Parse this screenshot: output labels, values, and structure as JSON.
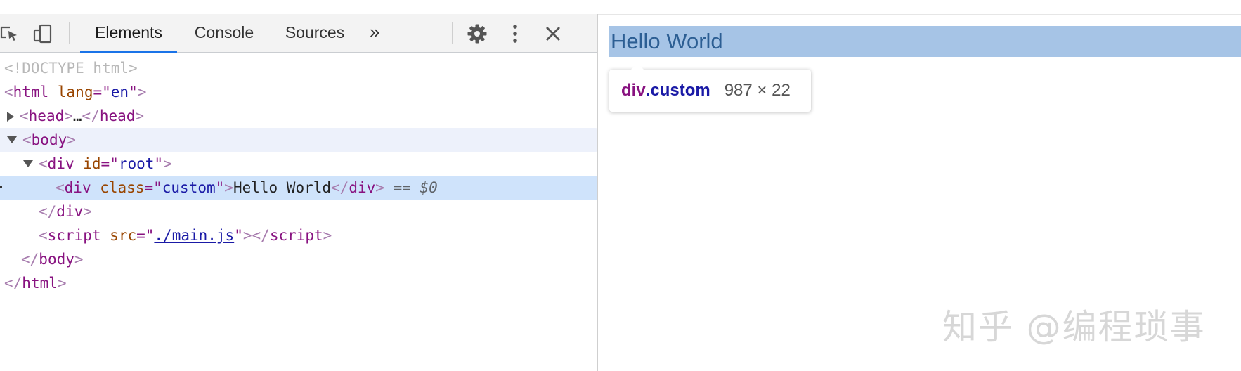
{
  "devtools": {
    "tabs": [
      {
        "label": "Elements",
        "active": true
      },
      {
        "label": "Console",
        "active": false
      },
      {
        "label": "Sources",
        "active": false
      }
    ],
    "more_tabs": "»",
    "icons": [
      "inspect-element-icon",
      "device-toggle-icon",
      "settings-gear-icon",
      "kebab-menu-icon",
      "close-icon"
    ]
  },
  "tree": {
    "doctype": "<!DOCTYPE html>",
    "html_tag": "html",
    "lang_attr": "lang",
    "lang_value": "en",
    "head_tag": "head",
    "head_ellipsis": "…",
    "body_tag": "body",
    "div_tag": "div",
    "id_attr": "id",
    "id_value": "root",
    "class_attr": "class",
    "class_value": "custom",
    "selected_text": "Hello World",
    "selected_marker_eq": "==",
    "selected_marker_var": "$0",
    "script_tag": "script",
    "src_attr": "src",
    "src_value": "./main.js"
  },
  "page": {
    "hello_text": "Hello World",
    "tooltip": {
      "tag": "div",
      "class": ".custom",
      "dimensions": "987 × 22"
    },
    "watermark": "知乎 @编程琐事"
  },
  "colors": {
    "accent": "#1a73e8",
    "selection": "#cfe3fb",
    "highlight": "#a6c4e6"
  }
}
